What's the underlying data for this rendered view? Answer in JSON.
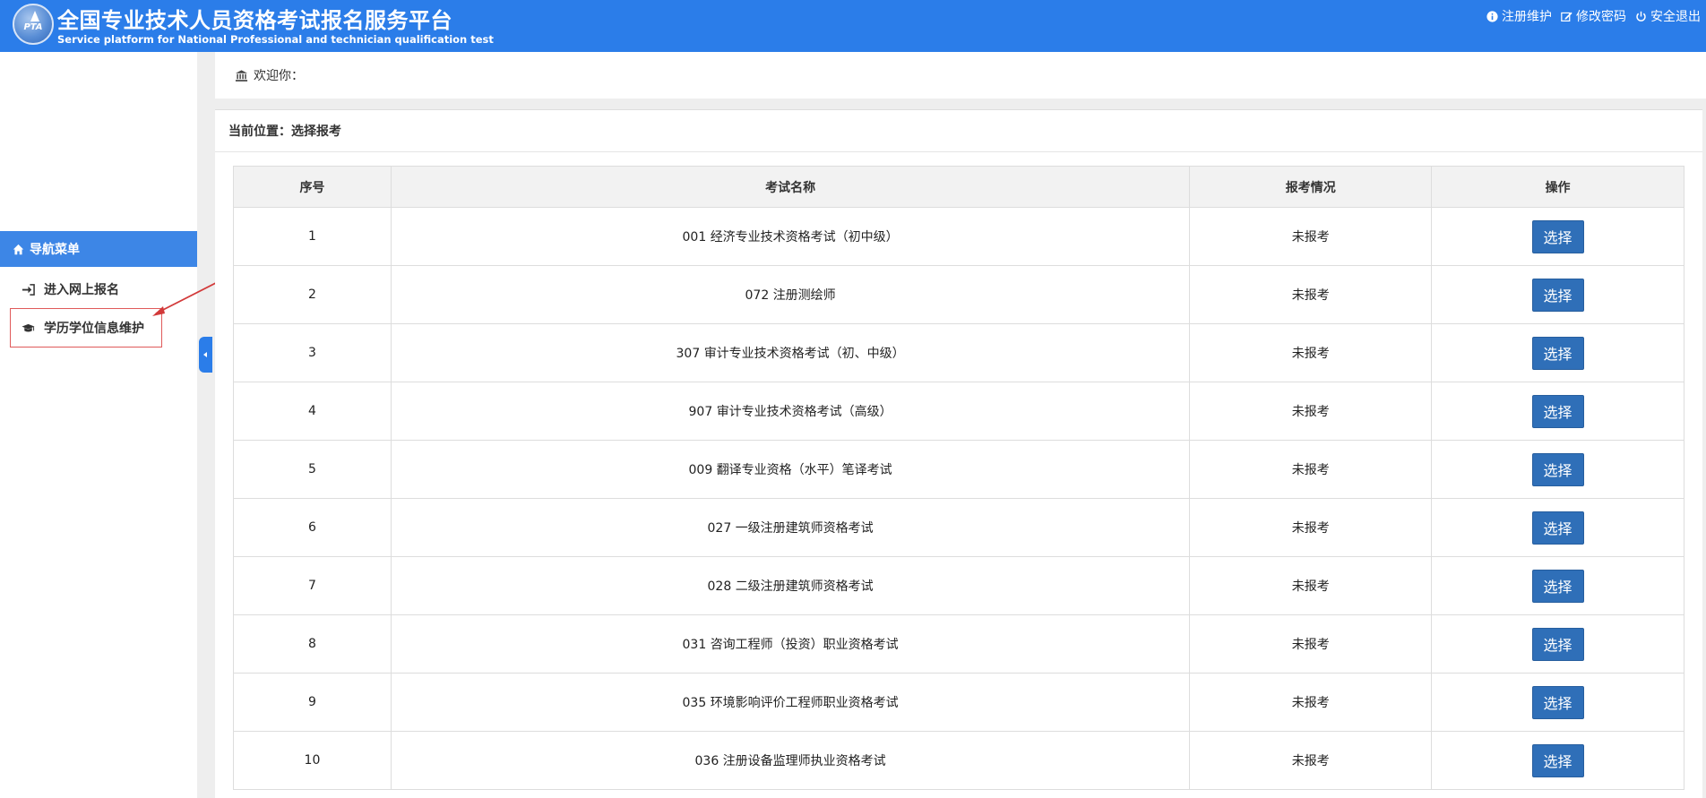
{
  "header": {
    "logo_text": "PTA",
    "title_cn": "全国专业技术人员资格考试报名服务平台",
    "title_en": "Service platform for National Professional and technician qualification test",
    "links": [
      "注册维护",
      "修改密码",
      "安全退出"
    ]
  },
  "sidebar": {
    "nav_header": "导航菜单",
    "items": [
      "进入网上报名",
      "学历学位信息维护"
    ]
  },
  "welcome": {
    "text": "欢迎你："
  },
  "breadcrumb": {
    "text": "当前位置：选择报考"
  },
  "table": {
    "headers": [
      "序号",
      "考试名称",
      "报考情况",
      "操作"
    ],
    "rows": [
      {
        "no": "1",
        "name": "001 经济专业技术资格考试（初中级）",
        "status": "未报考",
        "action": "选择"
      },
      {
        "no": "2",
        "name": "072 注册测绘师",
        "status": "未报考",
        "action": "选择"
      },
      {
        "no": "3",
        "name": "307 审计专业技术资格考试（初、中级）",
        "status": "未报考",
        "action": "选择"
      },
      {
        "no": "4",
        "name": "907 审计专业技术资格考试（高级）",
        "status": "未报考",
        "action": "选择"
      },
      {
        "no": "5",
        "name": "009 翻译专业资格（水平）笔译考试",
        "status": "未报考",
        "action": "选择"
      },
      {
        "no": "6",
        "name": "027 一级注册建筑师资格考试",
        "status": "未报考",
        "action": "选择"
      },
      {
        "no": "7",
        "name": "028 二级注册建筑师资格考试",
        "status": "未报考",
        "action": "选择"
      },
      {
        "no": "8",
        "name": "031 咨询工程师（投资）职业资格考试",
        "status": "未报考",
        "action": "选择"
      },
      {
        "no": "9",
        "name": "035 环境影响评价工程师职业资格考试",
        "status": "未报考",
        "action": "选择"
      },
      {
        "no": "10",
        "name": "036 注册设备监理师执业资格考试",
        "status": "未报考",
        "action": "选择"
      }
    ]
  },
  "colors": {
    "header_bg": "#2b7de9",
    "nav_header_bg": "#3d86e6",
    "button_bg": "#2f6fb8",
    "highlight_border": "#e05a5a",
    "annotation_arrow": "#d23a3a"
  },
  "icons": {
    "info": "info-circle-icon",
    "edit": "edit-icon",
    "logout": "power-icon",
    "home": "home-icon",
    "signin": "sign-in-icon",
    "graduation": "graduation-cap-icon",
    "bank": "bank-icon"
  }
}
